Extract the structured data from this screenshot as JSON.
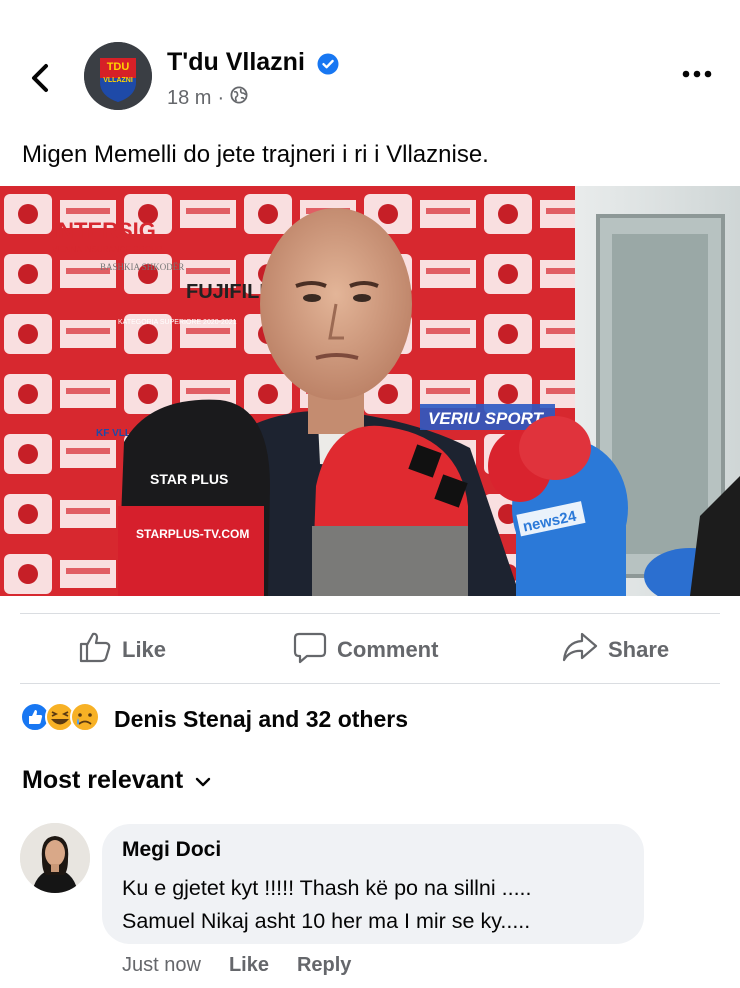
{
  "post": {
    "page_name": "T'du Vllazni",
    "time": "18 m",
    "separator": "·",
    "text": "Migen Memelli do jete trajneri i ri i Vllaznise.",
    "avatar_text": {
      "line1": "TDU",
      "line2": "VLLAZNI"
    }
  },
  "photo": {
    "sponsor_texts": [
      "INTERSIG",
      "VIENNA INSURANCE GROUP",
      "FUJIFILM",
      "BASHKIA SHKODËR",
      "KATEGORIA SUPERIORE 2020-2021",
      "KF VLLAZNIA",
      "VERIU SPORT",
      "STAR PLUS",
      "STARPLUS-TV.COM",
      "news24"
    ]
  },
  "actions": {
    "like": "Like",
    "comment": "Comment",
    "share": "Share"
  },
  "reactions": {
    "text": "Denis Stenaj and 32 others",
    "icons": [
      "like-reaction-icon",
      "haha-reaction-icon",
      "sad-reaction-icon"
    ]
  },
  "comments": {
    "sort_label": "Most relevant",
    "items": [
      {
        "author": "Megi Doci",
        "line1": "Ku e gjetet kyt !!!!! Thash kë po na sillni .....",
        "line2": "Samuel Nikaj asht 10 her ma I mir se ky.....",
        "time": "Just now",
        "like": "Like",
        "reply": "Reply"
      }
    ]
  },
  "colors": {
    "verified": "#1877f2",
    "secondary_text": "#65676b",
    "bubble": "#f0f2f5",
    "board_red": "#d7282f"
  }
}
